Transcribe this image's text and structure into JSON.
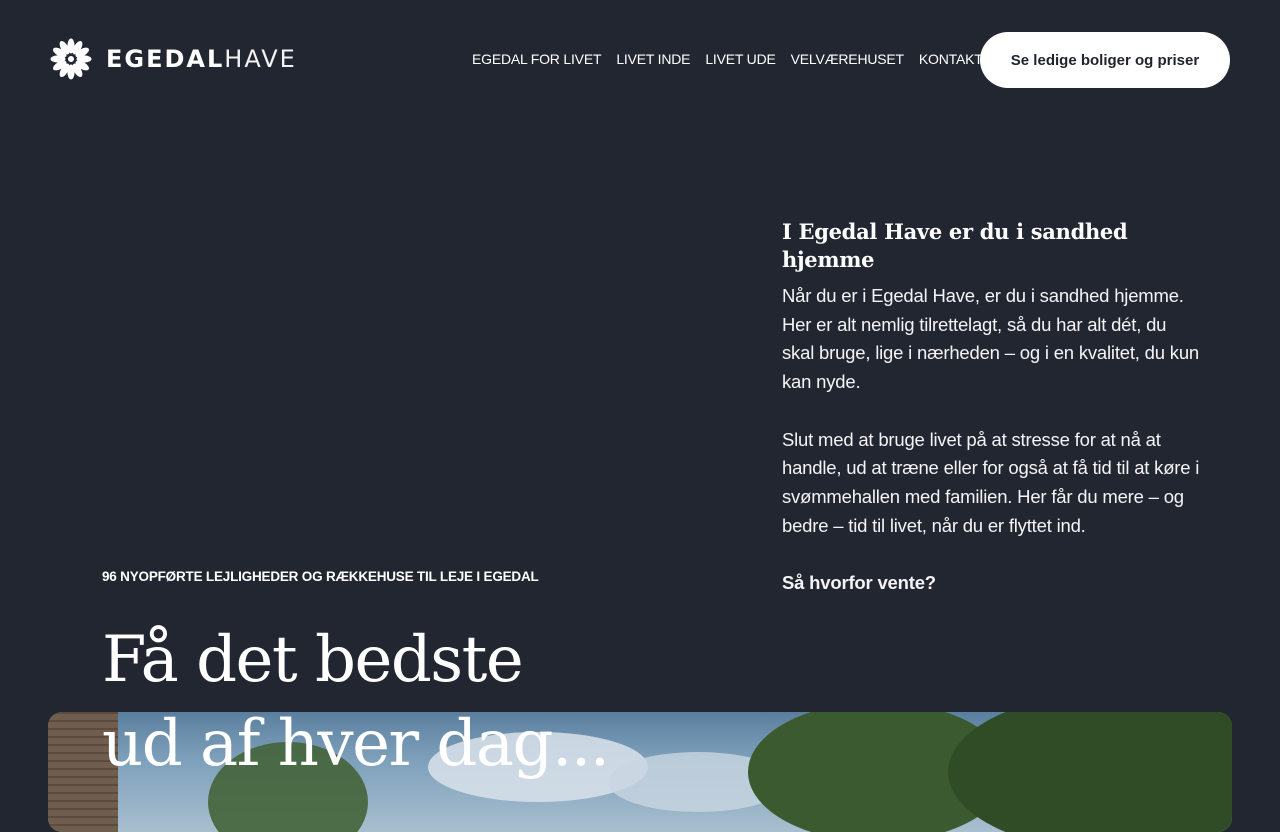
{
  "brand": {
    "name_bold": "EGEDAL",
    "name_thin": "HAVE",
    "logo_icon": "flower-icon"
  },
  "nav": {
    "items": [
      {
        "label": "EGEDAL FOR LIVET"
      },
      {
        "label": "LIVET INDE"
      },
      {
        "label": "LIVET UDE"
      },
      {
        "label": "VELVÆREHUSET"
      },
      {
        "label": "KONTAKT"
      }
    ],
    "separator": "|",
    "cta_label": "Se ledige boliger og priser"
  },
  "intro": {
    "heading": "I Egedal Have er du i sandhed hjemme",
    "paragraph_1": "Når du er i Egedal Have, er du i sandhed hjemme.  Her er alt nemlig tilrettelagt, så du har alt dét, du skal bruge, lige i nærheden – og i en kvalitet, du kun kan nyde.",
    "paragraph_2": "Slut med at bruge livet på at stresse for at nå at handle, ud at træne eller for også at få tid til at køre i svømmehallen med familien. Her får du mere – og bedre – tid til livet, når du er flyttet ind.",
    "closing": "Så hvorfor vente?"
  },
  "hero": {
    "eyebrow": "96 NYOPFØRTE LEJLIGHEDER OG RÆKKEHUSE TIL LEJE I EGEDAL",
    "headline_line_1": "Få det bedste",
    "headline_line_2": "ud af hver dag..."
  },
  "colors": {
    "background": "#222631",
    "text": "#ffffff",
    "cta_background": "#ffffff",
    "cta_text": "#1f232d"
  }
}
